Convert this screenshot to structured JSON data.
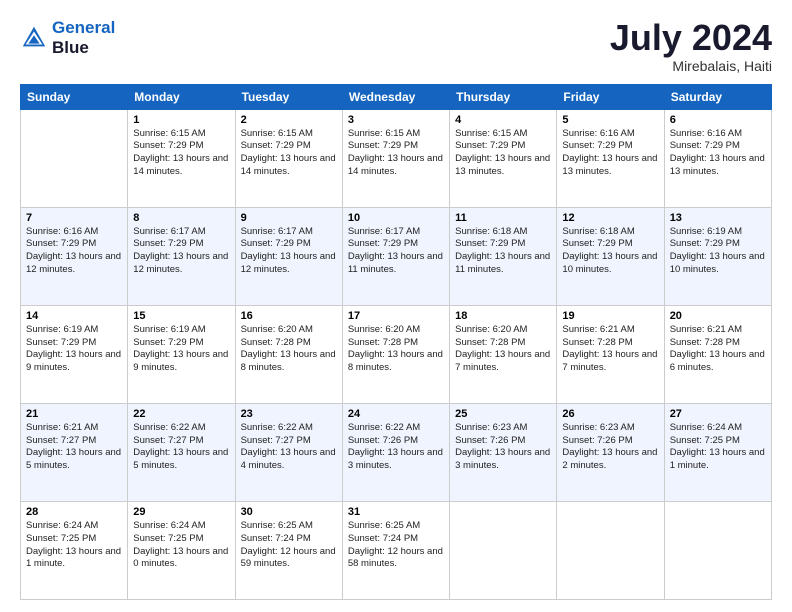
{
  "header": {
    "logo_line1": "General",
    "logo_line2": "Blue",
    "month": "July 2024",
    "location": "Mirebalais, Haiti"
  },
  "days_of_week": [
    "Sunday",
    "Monday",
    "Tuesday",
    "Wednesday",
    "Thursday",
    "Friday",
    "Saturday"
  ],
  "weeks": [
    [
      {
        "day": "",
        "sunrise": "",
        "sunset": "",
        "daylight": ""
      },
      {
        "day": "1",
        "sunrise": "Sunrise: 6:15 AM",
        "sunset": "Sunset: 7:29 PM",
        "daylight": "Daylight: 13 hours and 14 minutes."
      },
      {
        "day": "2",
        "sunrise": "Sunrise: 6:15 AM",
        "sunset": "Sunset: 7:29 PM",
        "daylight": "Daylight: 13 hours and 14 minutes."
      },
      {
        "day": "3",
        "sunrise": "Sunrise: 6:15 AM",
        "sunset": "Sunset: 7:29 PM",
        "daylight": "Daylight: 13 hours and 14 minutes."
      },
      {
        "day": "4",
        "sunrise": "Sunrise: 6:15 AM",
        "sunset": "Sunset: 7:29 PM",
        "daylight": "Daylight: 13 hours and 13 minutes."
      },
      {
        "day": "5",
        "sunrise": "Sunrise: 6:16 AM",
        "sunset": "Sunset: 7:29 PM",
        "daylight": "Daylight: 13 hours and 13 minutes."
      },
      {
        "day": "6",
        "sunrise": "Sunrise: 6:16 AM",
        "sunset": "Sunset: 7:29 PM",
        "daylight": "Daylight: 13 hours and 13 minutes."
      }
    ],
    [
      {
        "day": "7",
        "sunrise": "Sunrise: 6:16 AM",
        "sunset": "Sunset: 7:29 PM",
        "daylight": "Daylight: 13 hours and 12 minutes."
      },
      {
        "day": "8",
        "sunrise": "Sunrise: 6:17 AM",
        "sunset": "Sunset: 7:29 PM",
        "daylight": "Daylight: 13 hours and 12 minutes."
      },
      {
        "day": "9",
        "sunrise": "Sunrise: 6:17 AM",
        "sunset": "Sunset: 7:29 PM",
        "daylight": "Daylight: 13 hours and 12 minutes."
      },
      {
        "day": "10",
        "sunrise": "Sunrise: 6:17 AM",
        "sunset": "Sunset: 7:29 PM",
        "daylight": "Daylight: 13 hours and 11 minutes."
      },
      {
        "day": "11",
        "sunrise": "Sunrise: 6:18 AM",
        "sunset": "Sunset: 7:29 PM",
        "daylight": "Daylight: 13 hours and 11 minutes."
      },
      {
        "day": "12",
        "sunrise": "Sunrise: 6:18 AM",
        "sunset": "Sunset: 7:29 PM",
        "daylight": "Daylight: 13 hours and 10 minutes."
      },
      {
        "day": "13",
        "sunrise": "Sunrise: 6:19 AM",
        "sunset": "Sunset: 7:29 PM",
        "daylight": "Daylight: 13 hours and 10 minutes."
      }
    ],
    [
      {
        "day": "14",
        "sunrise": "Sunrise: 6:19 AM",
        "sunset": "Sunset: 7:29 PM",
        "daylight": "Daylight: 13 hours and 9 minutes."
      },
      {
        "day": "15",
        "sunrise": "Sunrise: 6:19 AM",
        "sunset": "Sunset: 7:29 PM",
        "daylight": "Daylight: 13 hours and 9 minutes."
      },
      {
        "day": "16",
        "sunrise": "Sunrise: 6:20 AM",
        "sunset": "Sunset: 7:28 PM",
        "daylight": "Daylight: 13 hours and 8 minutes."
      },
      {
        "day": "17",
        "sunrise": "Sunrise: 6:20 AM",
        "sunset": "Sunset: 7:28 PM",
        "daylight": "Daylight: 13 hours and 8 minutes."
      },
      {
        "day": "18",
        "sunrise": "Sunrise: 6:20 AM",
        "sunset": "Sunset: 7:28 PM",
        "daylight": "Daylight: 13 hours and 7 minutes."
      },
      {
        "day": "19",
        "sunrise": "Sunrise: 6:21 AM",
        "sunset": "Sunset: 7:28 PM",
        "daylight": "Daylight: 13 hours and 7 minutes."
      },
      {
        "day": "20",
        "sunrise": "Sunrise: 6:21 AM",
        "sunset": "Sunset: 7:28 PM",
        "daylight": "Daylight: 13 hours and 6 minutes."
      }
    ],
    [
      {
        "day": "21",
        "sunrise": "Sunrise: 6:21 AM",
        "sunset": "Sunset: 7:27 PM",
        "daylight": "Daylight: 13 hours and 5 minutes."
      },
      {
        "day": "22",
        "sunrise": "Sunrise: 6:22 AM",
        "sunset": "Sunset: 7:27 PM",
        "daylight": "Daylight: 13 hours and 5 minutes."
      },
      {
        "day": "23",
        "sunrise": "Sunrise: 6:22 AM",
        "sunset": "Sunset: 7:27 PM",
        "daylight": "Daylight: 13 hours and 4 minutes."
      },
      {
        "day": "24",
        "sunrise": "Sunrise: 6:22 AM",
        "sunset": "Sunset: 7:26 PM",
        "daylight": "Daylight: 13 hours and 3 minutes."
      },
      {
        "day": "25",
        "sunrise": "Sunrise: 6:23 AM",
        "sunset": "Sunset: 7:26 PM",
        "daylight": "Daylight: 13 hours and 3 minutes."
      },
      {
        "day": "26",
        "sunrise": "Sunrise: 6:23 AM",
        "sunset": "Sunset: 7:26 PM",
        "daylight": "Daylight: 13 hours and 2 minutes."
      },
      {
        "day": "27",
        "sunrise": "Sunrise: 6:24 AM",
        "sunset": "Sunset: 7:25 PM",
        "daylight": "Daylight: 13 hours and 1 minute."
      }
    ],
    [
      {
        "day": "28",
        "sunrise": "Sunrise: 6:24 AM",
        "sunset": "Sunset: 7:25 PM",
        "daylight": "Daylight: 13 hours and 1 minute."
      },
      {
        "day": "29",
        "sunrise": "Sunrise: 6:24 AM",
        "sunset": "Sunset: 7:25 PM",
        "daylight": "Daylight: 13 hours and 0 minutes."
      },
      {
        "day": "30",
        "sunrise": "Sunrise: 6:25 AM",
        "sunset": "Sunset: 7:24 PM",
        "daylight": "Daylight: 12 hours and 59 minutes."
      },
      {
        "day": "31",
        "sunrise": "Sunrise: 6:25 AM",
        "sunset": "Sunset: 7:24 PM",
        "daylight": "Daylight: 12 hours and 58 minutes."
      },
      {
        "day": "",
        "sunrise": "",
        "sunset": "",
        "daylight": ""
      },
      {
        "day": "",
        "sunrise": "",
        "sunset": "",
        "daylight": ""
      },
      {
        "day": "",
        "sunrise": "",
        "sunset": "",
        "daylight": ""
      }
    ]
  ]
}
